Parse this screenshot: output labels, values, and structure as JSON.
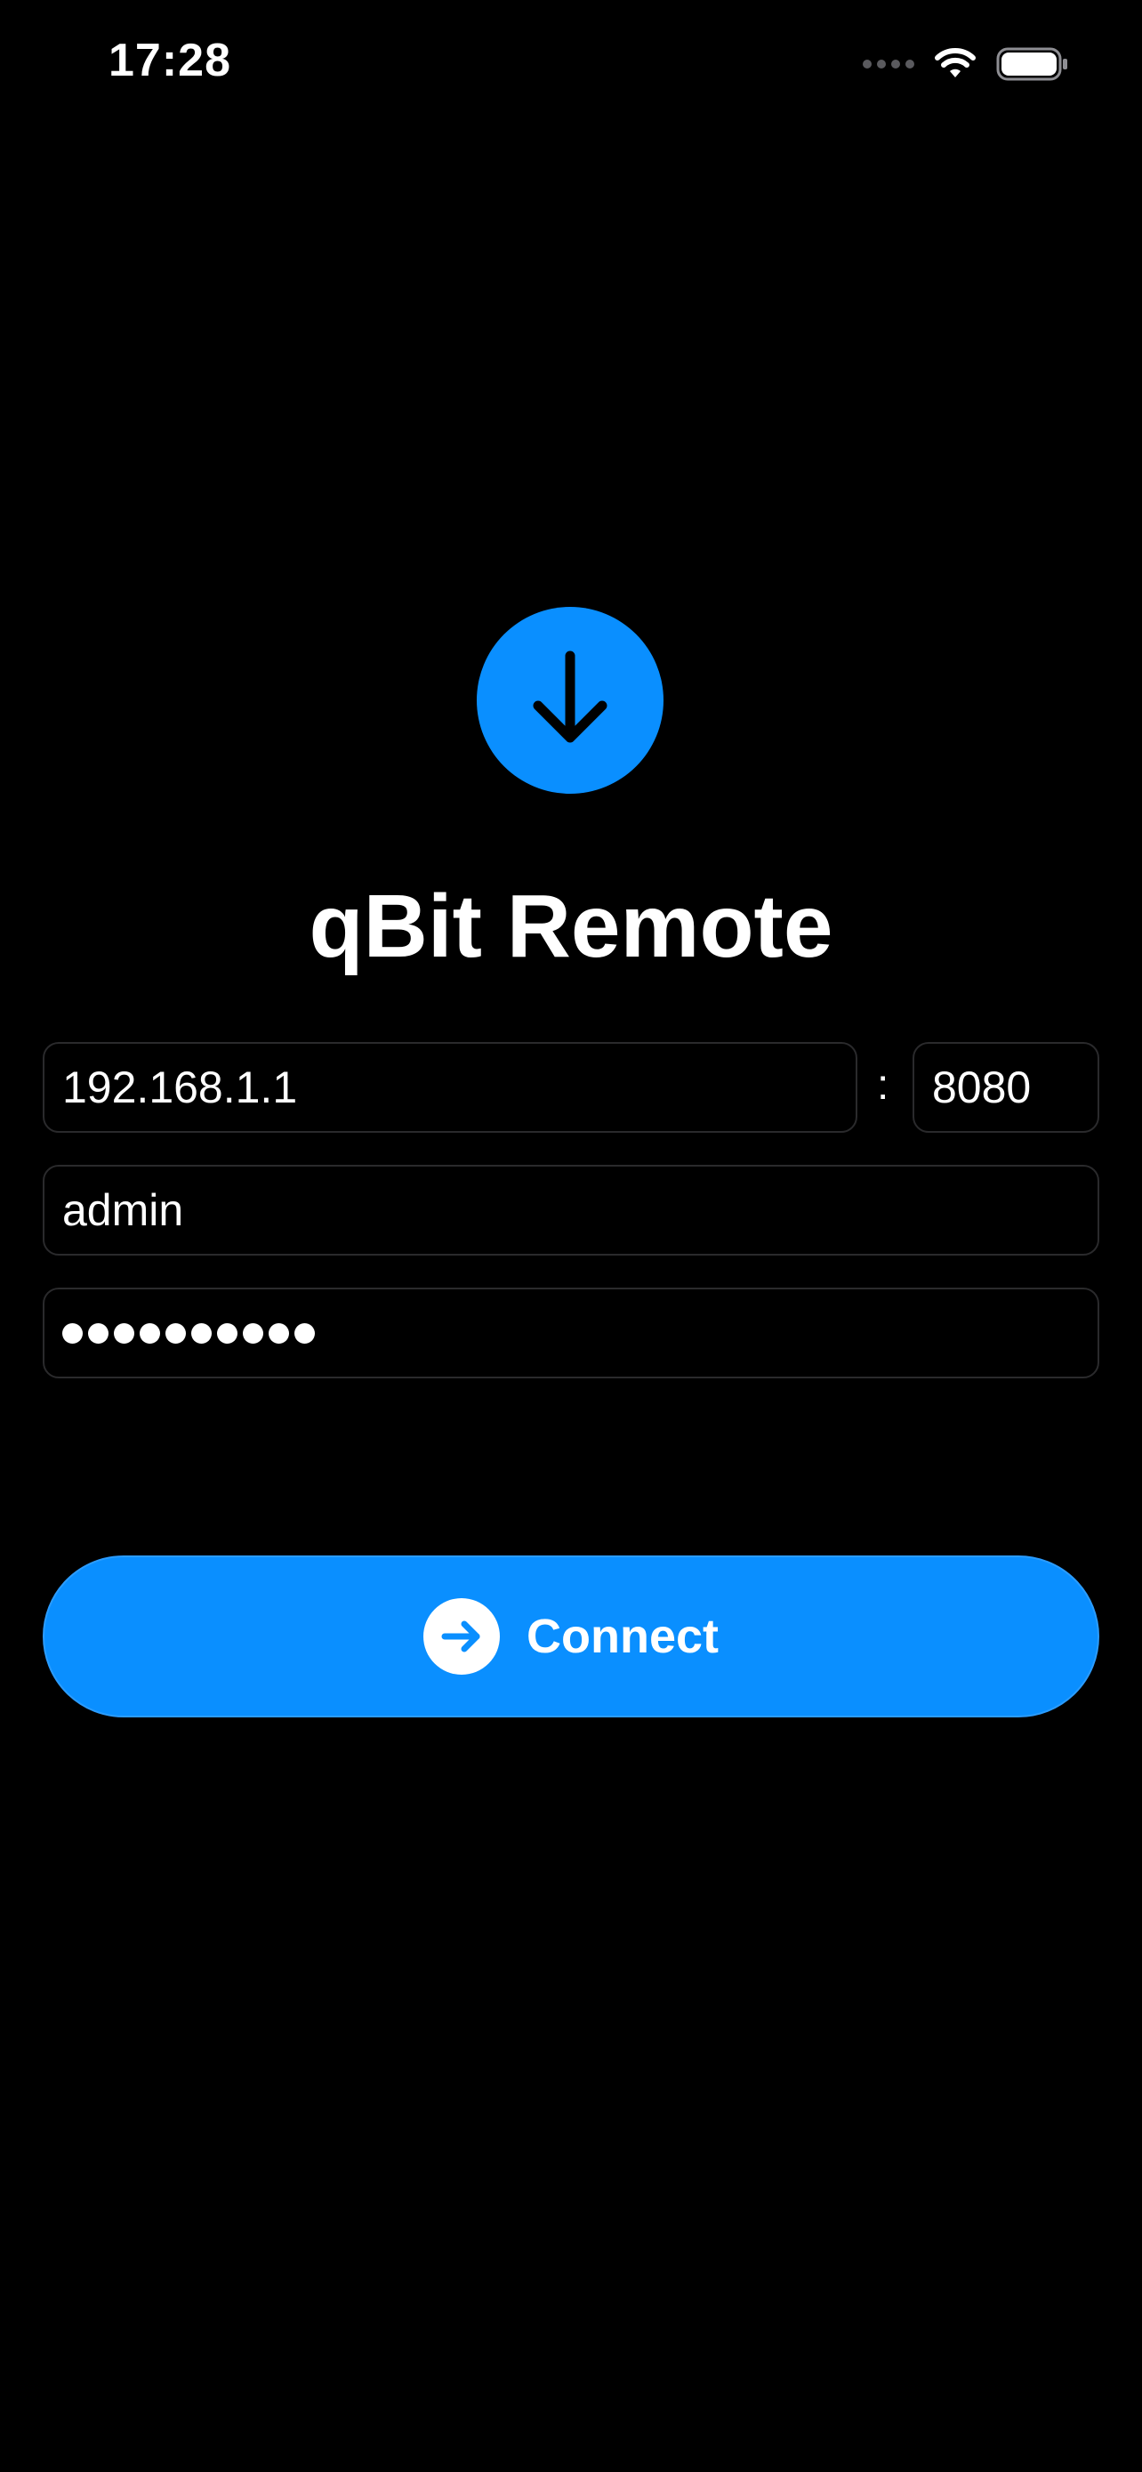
{
  "status_bar": {
    "time": "17:28"
  },
  "app": {
    "title": "qBit Remote",
    "logo_icon": "arrow-down-icon",
    "accent_color": "#0a8fff"
  },
  "form": {
    "host_value": "192.168.1.1",
    "port_separator": ":",
    "port_value": "8080",
    "username_value": "admin",
    "password_masked_length": 10
  },
  "connect_button": {
    "label": "Connect",
    "icon": "arrow-right-circle-icon"
  }
}
